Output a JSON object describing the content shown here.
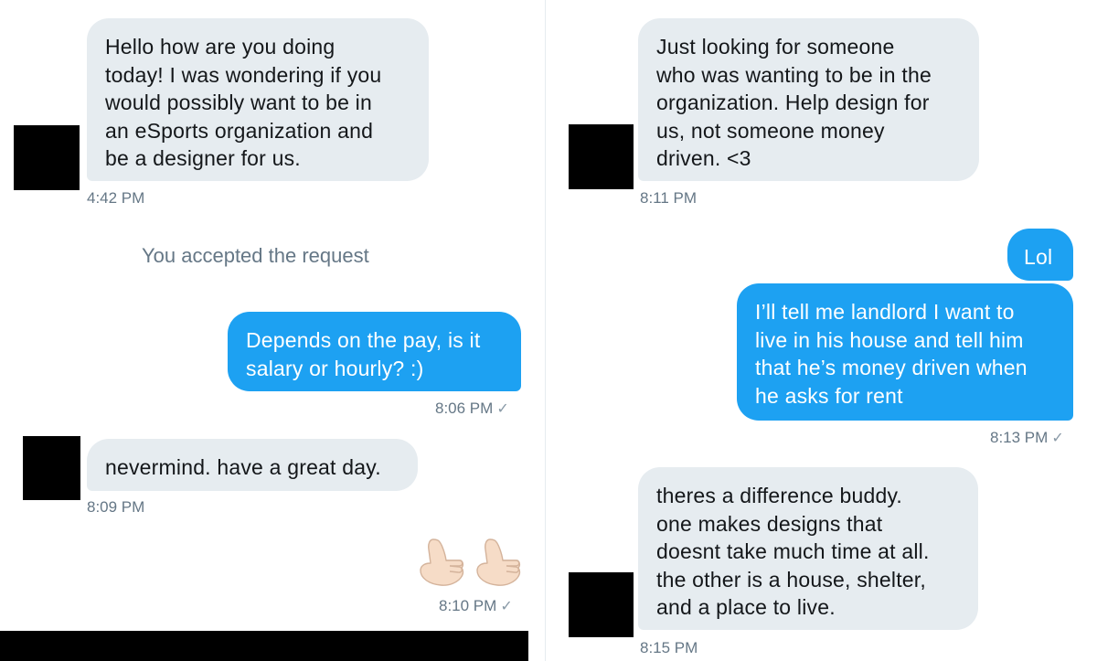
{
  "left": {
    "m1": {
      "text": "Hello how are you doing\ntoday! I was wondering if you\nwould possibly want to be in\nan eSports organization and\nbe a designer for us.",
      "time": "4:42 PM"
    },
    "system": "You accepted the request",
    "m2": {
      "text": "Depends on the pay, is it\nsalary or hourly? :)",
      "time": "8:06 PM",
      "check": "✓"
    },
    "m3": {
      "text": "nevermind. have a great day.",
      "time": "8:09 PM"
    },
    "m4": {
      "emoji": "call-me-hand-emoji x2",
      "time": "8:10 PM",
      "check": "✓"
    }
  },
  "right": {
    "m1": {
      "text": "Just looking for someone\nwho was wanting to be in the\norganization. Help design for\nus, not someone money\ndriven. <3",
      "time": "8:11 PM"
    },
    "m2": {
      "text": "Lol"
    },
    "m3": {
      "text": "I’ll tell me landlord I want to\nlive in his house and tell him\nthat he’s money driven when\nhe asks for rent",
      "time": "8:13 PM",
      "check": "✓"
    },
    "m4": {
      "text": "theres a difference buddy.\none makes designs that\ndoesnt take much time at all.\nthe other is a house, shelter,\nand a place to live.",
      "time": "8:15 PM"
    }
  },
  "colors": {
    "incoming_bubble": "#e6ecf0",
    "outgoing_bubble": "#1da1f2",
    "timestamp": "#657786",
    "redaction": "#000000"
  }
}
